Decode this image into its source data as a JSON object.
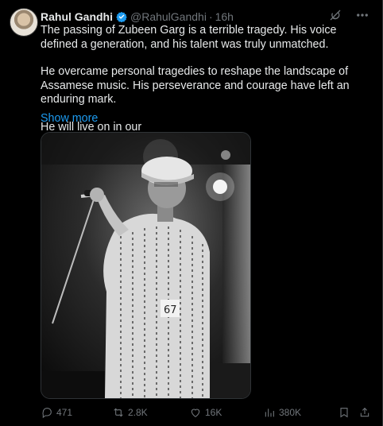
{
  "author": {
    "name": "Rahul Gandhi",
    "handle": "@RahulGandhi",
    "separator": "·",
    "time": "16h"
  },
  "body": {
    "paragraphs": [
      "The passing of Zubeen Garg is a terrible tragedy. His voice defined a generation, and his talent was truly unmatched.",
      "He overcame personal tragedies to reshape the landscape of Assamese music. His perseverance and courage have left an enduring mark.",
      "He will live on in our"
    ],
    "show_more": "Show more"
  },
  "actions": {
    "replies": "471",
    "reposts": "2.8K",
    "likes": "16K",
    "views": "380K"
  },
  "icons": {
    "verified": "verified-badge-icon",
    "grok": "grok-icon",
    "more": "more-options-icon",
    "reply": "reply-icon",
    "repost": "repost-icon",
    "like": "heart-icon",
    "views": "views-icon",
    "bookmark": "bookmark-icon",
    "share": "share-icon"
  },
  "colors": {
    "background": "#000000",
    "text": "#e7e9ea",
    "muted": "#71767b",
    "link": "#1d9bf0",
    "verified": "#1d9bf0"
  }
}
